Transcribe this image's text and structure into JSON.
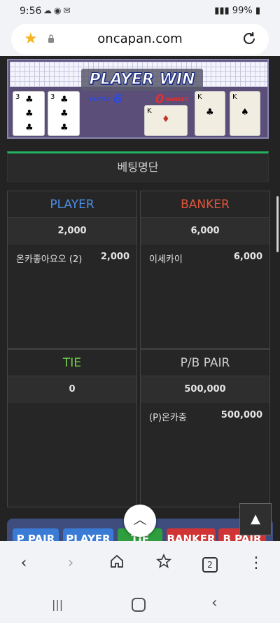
{
  "status": {
    "time": "9:56",
    "battery": "99%"
  },
  "browser": {
    "url": "oncapan.com",
    "tabs_count": "2"
  },
  "game": {
    "banner": "PLAYER WIN",
    "player_label": "PLAYER",
    "player_score": "6",
    "banker_label": "BANKER",
    "banker_score": "0",
    "player_cards": [
      {
        "rank": "3",
        "suit": "♣"
      },
      {
        "rank": "3",
        "suit": "♣"
      }
    ],
    "banker_cards": [
      {
        "rank": "K",
        "suit": "♦"
      },
      {
        "rank": "K",
        "suit": "♣"
      },
      {
        "rank": "K",
        "suit": "♠"
      }
    ]
  },
  "betting": {
    "header": "베팅명단",
    "panels": {
      "player": {
        "title": "PLAYER",
        "color": "#4a8ee8",
        "total": "2,000",
        "entries": [
          {
            "name": "온카좋아요오 (2)",
            "amount": "2,000"
          }
        ]
      },
      "banker": {
        "title": "BANKER",
        "color": "#e0543a",
        "total": "6,000",
        "entries": [
          {
            "name": "이세카이",
            "amount": "6,000"
          }
        ]
      },
      "tie": {
        "title": "TIE",
        "color": "#6fd24a",
        "total": "0",
        "entries": []
      },
      "pair": {
        "title": "P/B PAIR",
        "color": "#cfcfcf",
        "total": "500,000",
        "entries": [
          {
            "name": "(P)온카충",
            "amount": "500,000"
          }
        ]
      }
    }
  },
  "bet_buttons": [
    {
      "label": "P PAIR",
      "color": "#3a7bd5"
    },
    {
      "label": "PLAYER",
      "color": "#3a7bd5"
    },
    {
      "label": "TIE",
      "color": "#2e9e3e"
    },
    {
      "label": "BANKER",
      "color": "#d03434"
    },
    {
      "label": "B PAIR",
      "color": "#d03434"
    }
  ],
  "toolbar": {
    "tabs_count": "2"
  }
}
